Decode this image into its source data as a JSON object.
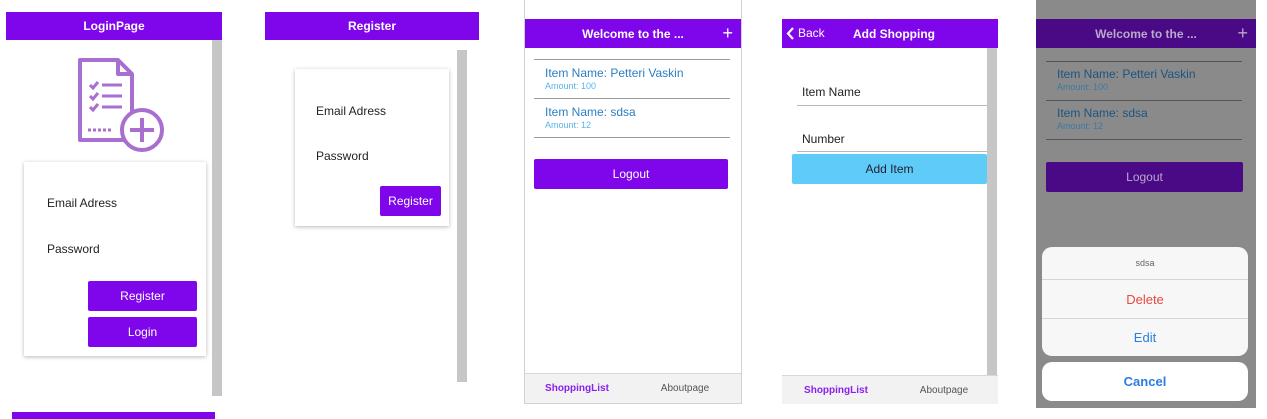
{
  "login": {
    "title": "LoginPage",
    "email_label": "Email Adress",
    "password_label": "Password",
    "register_label": "Register",
    "login_label": "Login"
  },
  "register": {
    "title": "Register",
    "email_label": "Email Adress",
    "password_label": "Password",
    "register_label": "Register"
  },
  "shopping": {
    "title": "Welcome to the ...",
    "add_icon": "+",
    "items": [
      {
        "name": "Item Name: Petteri Vaskin",
        "amount": "Amount: 100"
      },
      {
        "name": "Item Name: sdsa",
        "amount": "Amount: 12"
      }
    ],
    "logout_label": "Logout",
    "tabs": [
      "ShoppingList",
      "Aboutpage"
    ]
  },
  "add_shopping": {
    "back_label": "Back",
    "title": "Add Shopping",
    "item_name_label": "Item Name",
    "number_label": "Number",
    "add_item_label": "Add Item",
    "tabs": [
      "ShoppingList",
      "Aboutpage"
    ]
  },
  "action_sheet": {
    "title": "Welcome to the ...",
    "add_icon": "+",
    "items": [
      {
        "name": "Item Name: Petteri Vaskin",
        "amount": "Amount: 100"
      },
      {
        "name": "Item Name: sdsa",
        "amount": "Amount: 12"
      }
    ],
    "logout_label": "Logout",
    "sheet_title": "sdsa",
    "delete_label": "Delete",
    "edit_label": "Edit",
    "cancel_label": "Cancel"
  },
  "colors": {
    "header": "#7f06ea",
    "button": "#7f06ea",
    "add_item_button": "#5ecbf8",
    "item_link": "#2a7fc4",
    "delete": "#e84a3f",
    "edit": "#2b7de0"
  }
}
